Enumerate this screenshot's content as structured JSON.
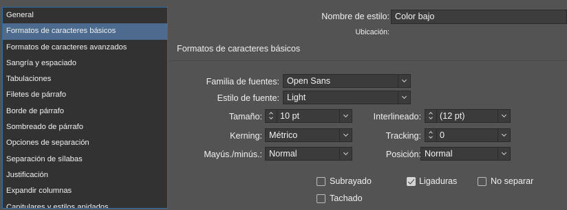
{
  "sidebar": {
    "items": [
      {
        "label": "General",
        "selected": false
      },
      {
        "label": "Formatos de caracteres básicos",
        "selected": true
      },
      {
        "label": "Formatos de caracteres avanzados",
        "selected": false
      },
      {
        "label": "Sangría y espaciado",
        "selected": false
      },
      {
        "label": "Tabulaciones",
        "selected": false
      },
      {
        "label": "Filetes de párrafo",
        "selected": false
      },
      {
        "label": "Borde de párrafo",
        "selected": false
      },
      {
        "label": "Sombreado de párrafo",
        "selected": false
      },
      {
        "label": "Opciones de separación",
        "selected": false
      },
      {
        "label": "Separación de sílabas",
        "selected": false
      },
      {
        "label": "Justificación",
        "selected": false
      },
      {
        "label": "Expandir columnas",
        "selected": false
      },
      {
        "label": "Capitulares y estilos anidados",
        "selected": false
      }
    ]
  },
  "header": {
    "style_name_label": "Nombre de estilo:",
    "style_name_value": "Color bajo",
    "location_label": "Ubicación:"
  },
  "section": {
    "title": "Formatos de caracteres básicos"
  },
  "fields": {
    "font_family": {
      "label": "Familia de fuentes:",
      "value": "Open Sans"
    },
    "font_style": {
      "label": "Estilo de fuente:",
      "value": "Light"
    },
    "size": {
      "label": "Tamaño:",
      "value": "10 pt"
    },
    "leading": {
      "label": "Interlineado:",
      "value": "(12 pt)"
    },
    "kerning": {
      "label": "Kerning:",
      "value": "Métrico"
    },
    "tracking": {
      "label": "Tracking:",
      "value": "0"
    },
    "case": {
      "label": "Mayús./minús.:",
      "value": "Normal"
    },
    "position": {
      "label": "Posición:",
      "value": "Normal"
    }
  },
  "checkboxes": {
    "underline": {
      "label": "Subrayado",
      "checked": false
    },
    "ligatures": {
      "label": "Ligaduras",
      "checked": true
    },
    "no_break": {
      "label": "No separar",
      "checked": false
    },
    "strikethrough": {
      "label": "Tachado",
      "checked": false
    }
  },
  "colors": {
    "accent": "#2d6ea8",
    "selected_item": "#4c6b8e",
    "panel_bg": "#535353",
    "sidebar_bg": "#323232"
  }
}
